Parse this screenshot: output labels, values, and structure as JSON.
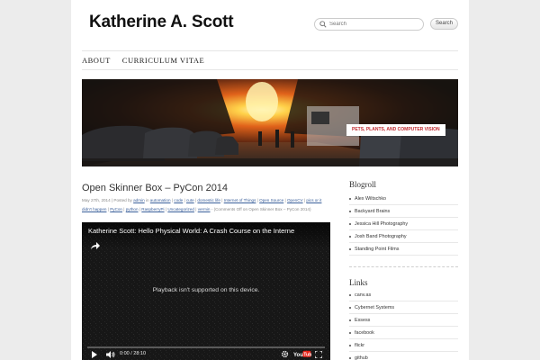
{
  "header": {
    "site_title": "Katherine A. Scott",
    "search_placeholder": "Search",
    "search_button": "Search",
    "tagline": "PETS, PLANTS, AND COMPUTER VISION"
  },
  "nav": {
    "items": [
      {
        "label": "ABOUT"
      },
      {
        "label": "CURRICULUM VITAE"
      }
    ]
  },
  "post": {
    "title": "Open Skinner Box – PyCon 2014",
    "meta_prefix": "May 27th, 2014 | Posted by ",
    "author": "admin",
    "meta_in": " in ",
    "categories": [
      "automation",
      "code",
      "cute",
      "domestic life",
      "Internet of Things",
      "Open Source",
      "OpenCV",
      "pics or it didn't happen",
      "PyCon",
      "python",
      "RaspberryPi",
      "Uncategorized",
      "vermin"
    ],
    "comments": " - (Comments Off on Open Skinner Box – PyCon 2014)"
  },
  "video": {
    "title": "Katherine Scott: Hello Physical World: A Crash Course on the Interne",
    "message": "Playback isn't supported on this device.",
    "time": "0:00 / 28:10",
    "brand": "YouTube"
  },
  "sidebar": {
    "blogroll": {
      "title": "Blogroll",
      "links": [
        "Alex Wiltschko",
        "Backyard Brains",
        "Jessica Hill Photography",
        "Josh Band Photography",
        "Standing Point Films"
      ]
    },
    "links": {
      "title": "Links",
      "items": [
        "canv.as",
        "Cybernet Systems",
        "Essess",
        "facebook",
        "flickr",
        "github"
      ]
    }
  },
  "colors": {
    "accent": "#c0282d",
    "link": "#3a5f9a",
    "page_bg": "#ececec"
  }
}
